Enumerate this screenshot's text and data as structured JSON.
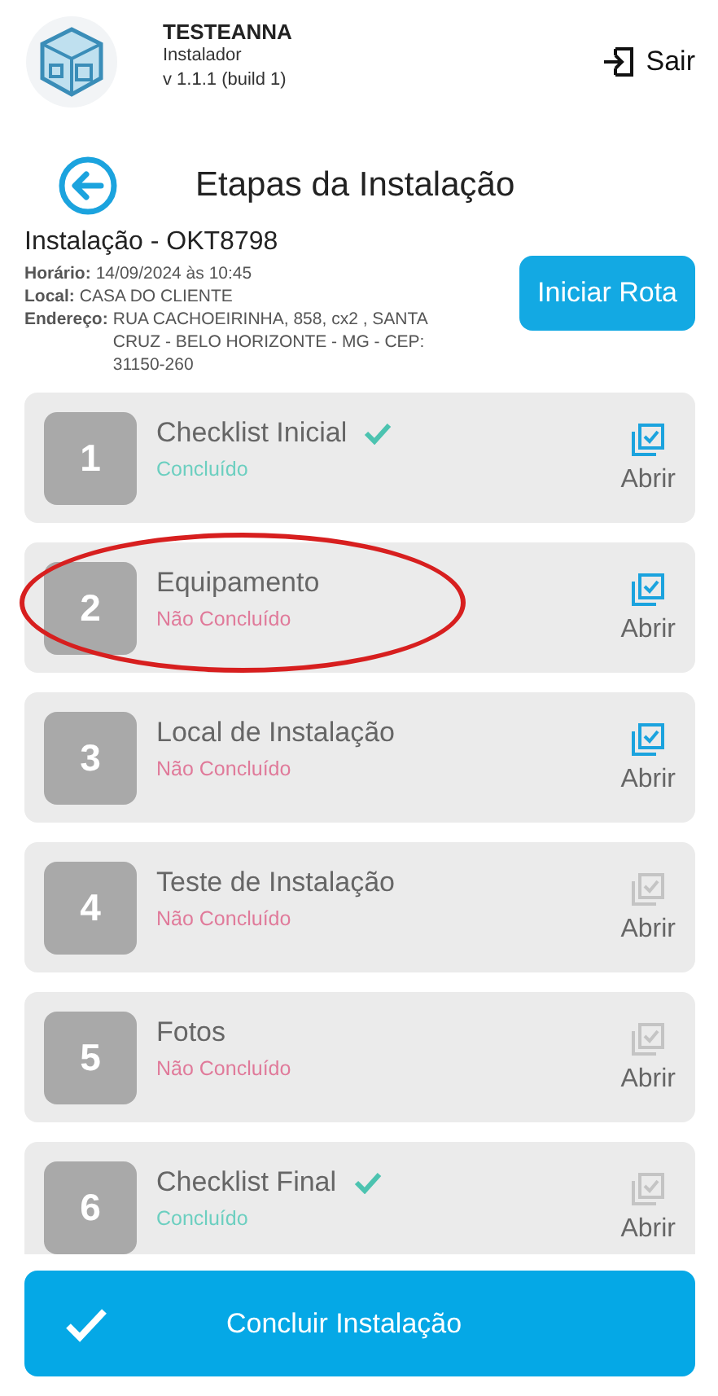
{
  "app": {
    "name": "TESTEANNA",
    "role": "Instalador",
    "version": "v 1.1.1 (build 1)",
    "logout": "Sair"
  },
  "page_title": "Etapas da Instalação",
  "installation": {
    "title": "Instalação - OKT8798",
    "fields": [
      {
        "label": "Horário:",
        "value": "14/09/2024 às 10:45"
      },
      {
        "label": "Local:",
        "value": "CASA DO CLIENTE"
      },
      {
        "label": "Endereço:",
        "value": "RUA CACHOEIRINHA, 858, cx2 ,  SANTA CRUZ  -  BELO HORIZONTE  -  MG  -  CEP: 31150-260"
      }
    ],
    "route_button": "Iniciar Rota"
  },
  "steps": [
    {
      "number": "1",
      "title": "Checklist Inicial",
      "status": "Concluído",
      "done": true,
      "open_enabled": true,
      "open_label": "Abrir",
      "circled": false
    },
    {
      "number": "2",
      "title": "Equipamento",
      "status": "Não Concluído",
      "done": false,
      "open_enabled": true,
      "open_label": "Abrir",
      "circled": true
    },
    {
      "number": "3",
      "title": "Local de Instalação",
      "status": "Não Concluído",
      "done": false,
      "open_enabled": true,
      "open_label": "Abrir",
      "circled": false
    },
    {
      "number": "4",
      "title": "Teste de Instalação",
      "status": "Não Concluído",
      "done": false,
      "open_enabled": false,
      "open_label": "Abrir",
      "circled": false
    },
    {
      "number": "5",
      "title": "Fotos",
      "status": "Não Concluído",
      "done": false,
      "open_enabled": false,
      "open_label": "Abrir",
      "circled": false
    },
    {
      "number": "6",
      "title": "Checklist Final",
      "status": "Concluído",
      "done": true,
      "open_enabled": false,
      "open_label": "Abrir",
      "circled": false
    }
  ],
  "finish_button": "Concluir Instalação"
}
